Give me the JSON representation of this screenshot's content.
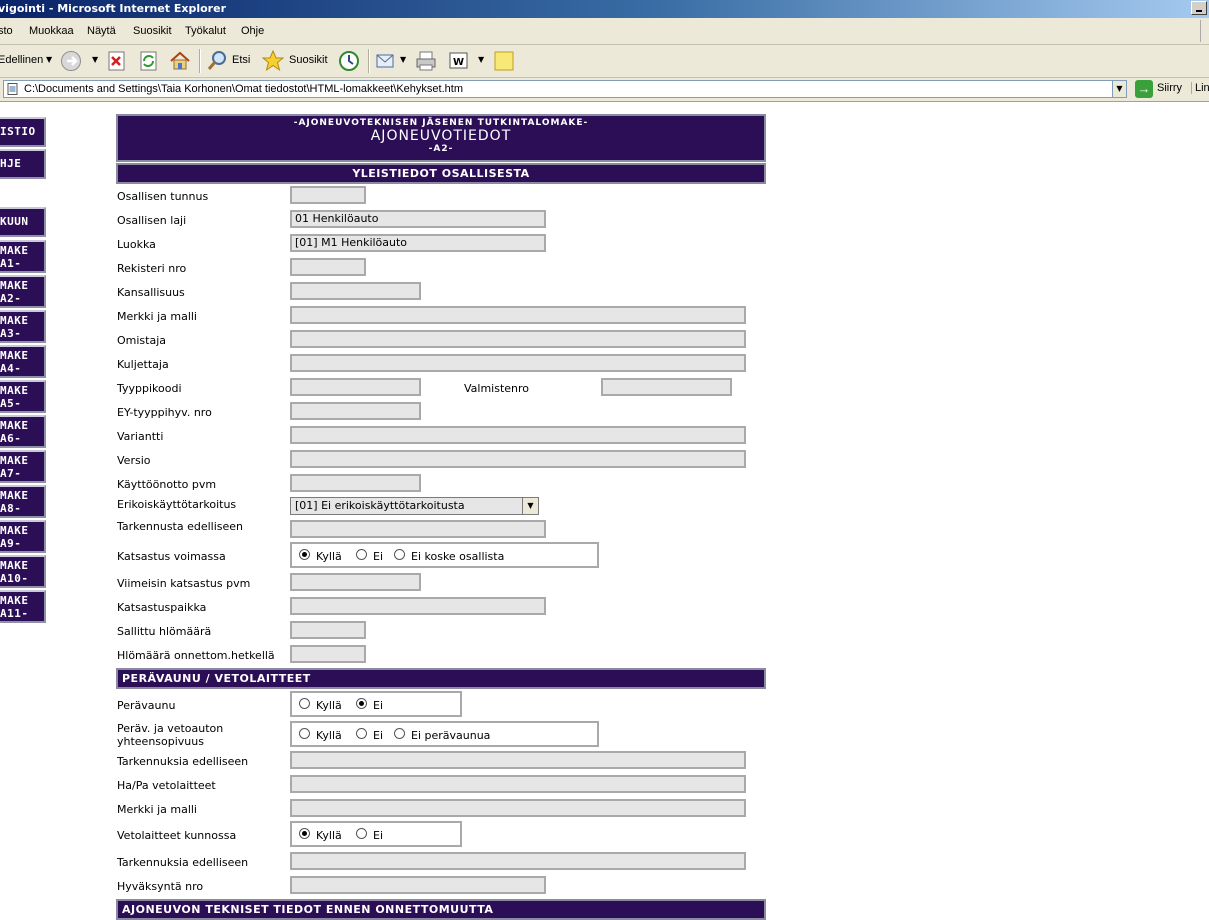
{
  "window": {
    "title": "vigointi - Microsoft Internet Explorer"
  },
  "menu": [
    "sto",
    "Muokkaa",
    "Näytä",
    "Suosikit",
    "Työkalut",
    "Ohje"
  ],
  "toolbar": {
    "back": "Edellinen",
    "search": "Etsi",
    "favorites": "Suosikit"
  },
  "address": {
    "url": "C:\\Documents and Settings\\Taia Korhonen\\Omat tiedostot\\HTML-lomakkeet\\Kehykset.htm",
    "go": "Siirry",
    "links": "Lin"
  },
  "nav": [
    "ISTIO",
    "HJE",
    "KUUN",
    "MAKE\nA1-",
    "MAKE\nA2-",
    "MAKE\nA3-",
    "MAKE\nA4-",
    "MAKE\nA5-",
    "MAKE\nA6-",
    "MAKE\nA7-",
    "MAKE\nA8-",
    "MAKE\nA9-",
    "MAKE\nA10-",
    "MAKE\nA11-"
  ],
  "form": {
    "header_line1": "-AJONEUVOTEKNISEN JÄSENEN TUTKINTALOMAKE-",
    "header_line2": "AJONEUVOTIEDOT",
    "header_line3": "-A2-",
    "section1": "YLEISTIEDOT OSALLISESTA",
    "labels": {
      "osallisen_tunnus": "Osallisen tunnus",
      "osallisen_laji": "Osallisen laji",
      "luokka": "Luokka",
      "rekisteri": "Rekisteri nro",
      "kansallisuus": "Kansallisuus",
      "merkki": "Merkki ja malli",
      "omistaja": "Omistaja",
      "kuljettaja": "Kuljettaja",
      "tyyppikoodi": "Tyyppikoodi",
      "valmistenro": "Valmistenro",
      "ey": "EY-tyyppihyv. nro",
      "variantti": "Variantti",
      "versio": "Versio",
      "kayttoonotto": "Käyttöönotto pvm",
      "erikois": "Erikoiskäyttötarkoitus",
      "tarkennusta": "Tarkennusta edelliseen",
      "katsastus_voimassa": "Katsastus voimassa",
      "viimeisin": "Viimeisin katsastus pvm",
      "katsastuspaikka": "Katsastuspaikka",
      "sallittu": "Sallittu hlömäärä",
      "hlomaara": "Hlömäärä onnettom.hetkellä"
    },
    "values": {
      "osallisen_laji": "01 Henkilöauto",
      "luokka": "[01] M1 Henkilöauto",
      "erikois": "[01] Ei erikoiskäyttötarkoitusta"
    },
    "katsastus_options": [
      "Kyllä",
      "Ei",
      "Ei koske osallista"
    ],
    "katsastus_selected": "Kyllä",
    "section2": "PERÄVAUNU / VETOLAITTEET",
    "labels2": {
      "peravaunu": "Perävaunu",
      "yhteensopivuus_1": "Peräv. ja vetoauton",
      "yhteensopivuus_2": "yhteensopivuus",
      "tarkennuksia1": "Tarkennuksia edelliseen",
      "hapa": "Ha/Pa vetolaitteet",
      "merkki2": "Merkki ja malli",
      "vetolaitteet": "Vetolaitteet kunnossa",
      "tarkennuksia2": "Tarkennuksia edelliseen",
      "hyvaksynta": "Hyväksyntä nro"
    },
    "peravaunu_options": [
      "Kyllä",
      "Ei"
    ],
    "peravaunu_selected": "Ei",
    "yhteensopivuus_options": [
      "Kyllä",
      "Ei",
      "Ei perävaunua"
    ],
    "yhteensopivuus_selected": "",
    "vetolaitteet_options": [
      "Kyllä",
      "Ei"
    ],
    "vetolaitteet_selected": "Kyllä",
    "section3": "AJONEUVON TEKNISET TIEDOT ENNEN ONNETTOMUUTTA"
  }
}
